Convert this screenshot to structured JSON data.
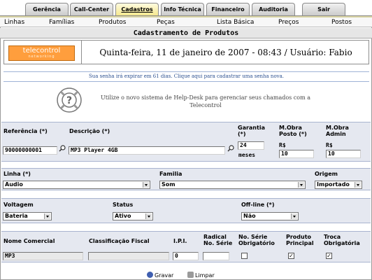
{
  "tabs": [
    {
      "label": "Gerência",
      "active": false
    },
    {
      "label": "Call-Center",
      "active": false
    },
    {
      "label": "Cadastros",
      "active": true
    },
    {
      "label": "Info Técnica",
      "active": false
    },
    {
      "label": "Financeiro",
      "active": false
    },
    {
      "label": "Auditoria",
      "active": false
    },
    {
      "label": "Sair",
      "active": false
    }
  ],
  "submenu": [
    "Linhas",
    "Famílias",
    "Produtos",
    "Peças",
    "Lista Básica",
    "Preços",
    "Postos"
  ],
  "page_title": "Cadastramento de Produtos",
  "header": {
    "logo_main": "telecontrol",
    "logo_sub": "networking",
    "date_user": "Quinta-feira, 11 de janeiro de 2007 - 08:43 / Usuário: Fabio"
  },
  "expire_notice": "Sua senha irá expirar em 61 dias. Clique aqui para cadastrar uma senha nova.",
  "helpdesk_text": "Utilize o novo sistema de Help-Desk para gerenciar seus chamados com a Telecontrol",
  "form": {
    "referencia_label": "Referência (*)",
    "referencia_value": "90000000001",
    "descricao_label": "Descrição (*)",
    "descricao_value": "MP3 Player 4GB",
    "garantia_label": "Garantia (*)",
    "garantia_value": "24",
    "garantia_unit": "meses",
    "mobra_posto_label": "M.Obra Posto (*)",
    "mobra_posto_currency": "R$",
    "mobra_posto_value": "10",
    "mobra_admin_label": "M.Obra Admin",
    "mobra_admin_currency": "R$",
    "mobra_admin_value": "10",
    "linha_label": "Linha (*)",
    "linha_value": "Audio",
    "familia_label": "Familia",
    "familia_value": "Som",
    "origem_label": "Origem",
    "origem_value": "Importado",
    "voltagem_label": "Voltagem",
    "voltagem_value": "Bateria",
    "status_label": "Status",
    "status_value": "Ativo",
    "offline_label": "Off-line (*)",
    "offline_value": "Não",
    "nome_comercial_label": "Nome Comercial",
    "nome_comercial_value": "MP3",
    "classificacao_label": "Classificação Fiscal",
    "classificacao_value": "",
    "ipi_label": "I.P.I.",
    "ipi_value": "0",
    "radical_label": "Radical No. Série",
    "radical_value": "",
    "serie_obrig_label": "No. Série Obrigatório",
    "serie_obrig_checked": false,
    "produto_principal_label": "Produto Principal",
    "produto_principal_checked": true,
    "troca_obrig_label": "Troca Obrigatória",
    "troca_obrig_checked": true
  },
  "buttons": {
    "gravar": "Gravar",
    "limpar": "Limpar"
  },
  "colors": {
    "logo_orange": "#ff9e3d",
    "band_bg": "#e5e8f0",
    "active_tab": "#f4e78a",
    "notice_text": "#2a4f8f"
  }
}
